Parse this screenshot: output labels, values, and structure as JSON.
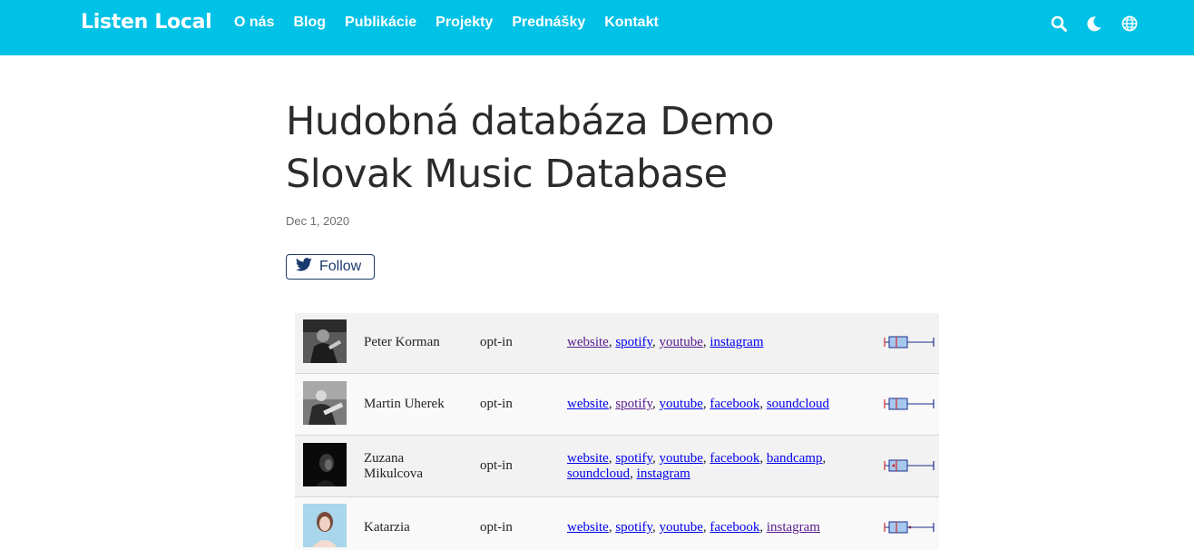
{
  "nav": {
    "brand": "Listen Local",
    "links": [
      "O nás",
      "Blog",
      "Publikácie",
      "Projekty",
      "Prednášky",
      "Kontakt"
    ],
    "icons": [
      "search-icon",
      "moon-icon",
      "globe-icon"
    ]
  },
  "article": {
    "title_line1": "Hudobná databáza Demo",
    "title_line2": "Slovak Music Database",
    "date": "Dec 1, 2020",
    "follow_label": "Follow"
  },
  "table": {
    "rows": [
      {
        "name": "Peter Korman",
        "consent": "opt-in",
        "links": [
          "website",
          "spotify",
          "youtube",
          "instagram"
        ],
        "visited": [
          true,
          false,
          true,
          false
        ]
      },
      {
        "name": "Martin Uherek",
        "consent": "opt-in",
        "links": [
          "website",
          "spotify",
          "youtube",
          "facebook",
          "soundcloud"
        ],
        "visited": [
          false,
          true,
          false,
          false,
          false
        ]
      },
      {
        "name": "Zuzana Mikulcova",
        "consent": "opt-in",
        "links": [
          "website",
          "spotify",
          "youtube",
          "facebook",
          "bandcamp",
          "soundcloud",
          "instagram"
        ],
        "visited": [
          false,
          false,
          false,
          false,
          false,
          false,
          false
        ]
      },
      {
        "name": "Katarzia",
        "consent": "opt-in",
        "links": [
          "website",
          "spotify",
          "youtube",
          "facebook",
          "instagram"
        ],
        "visited": [
          false,
          false,
          false,
          false,
          true
        ]
      }
    ]
  },
  "colors": {
    "navbar": "#00c1e6",
    "link": "#0000ee",
    "visited_link": "#551a8b",
    "follow_border": "#1a3a6e",
    "boxplot_fill": "#a6c8ee",
    "boxplot_line": "#1a2f8c",
    "boxplot_median": "#d22b2b"
  }
}
